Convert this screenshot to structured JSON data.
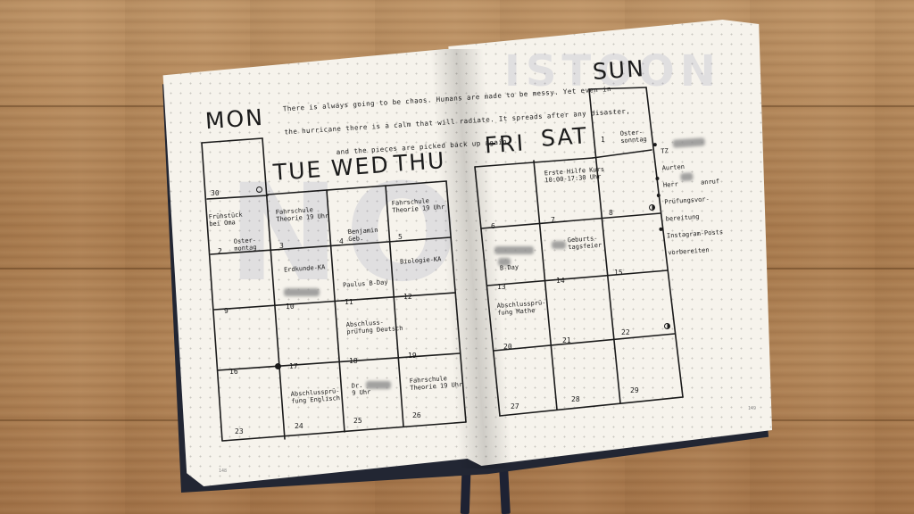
{
  "quote": {
    "lines": [
      "There is always going to be chaos. Humans are made to be messy. Yet even in",
      "the hurricane there is a calm that will radiate. It spreads after any disaster,",
      "and the pieces are picked back up again."
    ]
  },
  "day_headers": {
    "mon": "MON",
    "tue": "TUE",
    "wed": "WED",
    "thu": "THU",
    "fri": "FRI",
    "sat": "SAT",
    "sun": "SUN"
  },
  "cells": {
    "d30": "30",
    "d1": "1",
    "d2": "2",
    "d3": "3",
    "d4": "4",
    "d5": "5",
    "d6": "6",
    "d7": "7",
    "d8": "8",
    "d9": "9",
    "d10": "10",
    "d11": "11",
    "d12": "12",
    "d13": "13",
    "d14": "14",
    "d15": "15",
    "d16": "16",
    "d17": "17",
    "d18": "18",
    "d19": "19",
    "d20": "20",
    "d21": "21",
    "d22": "22",
    "d23": "23",
    "d24": "24",
    "d25": "25",
    "d26": "26",
    "d27": "27",
    "d28": "28",
    "d29": "29"
  },
  "events": {
    "mon_2a": "Frühstück\nbei Oma",
    "mon_2b": "Oster-\nmontag",
    "tue_3": "Fahrschule\nTheorie 19 Uhr",
    "wed_4": "Benjamin\nGeb.",
    "thu_5": "Fahrschule\nTheorie 19 Uhr",
    "tue_10": "Erdkunde-KA",
    "wed_11": "Paulus B-Day",
    "thu_12": "Biologie-KA",
    "wed_18": "Abschluss-\nprüfung Deutsch",
    "tue_24": "Abschlussprü-\nfung Englisch",
    "wed_25": "Dr.\n9 Uhr",
    "thu_26": "Fahrschule\nTheorie 19 Uhr",
    "sat_7": "Erste Hilfe Kurs\n10:00-17:30 Uhr",
    "sun_1": "Oster-\nsonntag",
    "fri_13": "B-Day",
    "sat_14": "Geburts-\ntagsfeier",
    "fri_20": "Abschlussprü-\nfung Mathe"
  },
  "todo": {
    "items": [
      "TZ",
      "Aurten",
      "Herr      anruf",
      "Prüfungsvor-\nbereitung",
      "Instagram-Posts\nvorbereiten"
    ]
  },
  "ghost": {
    "left": "NO",
    "right": "ISTOON"
  },
  "folios": {
    "left": "148",
    "right": "149"
  },
  "colors": {
    "wood": "#b58a5d",
    "paper": "#f6f3ec",
    "ink": "#1b1b1b",
    "cover": "#222633"
  },
  "icons": {
    "full_moon": "full-moon-icon",
    "half_moon": "half-moon-icon",
    "bullet": "bullet-dot-icon"
  }
}
